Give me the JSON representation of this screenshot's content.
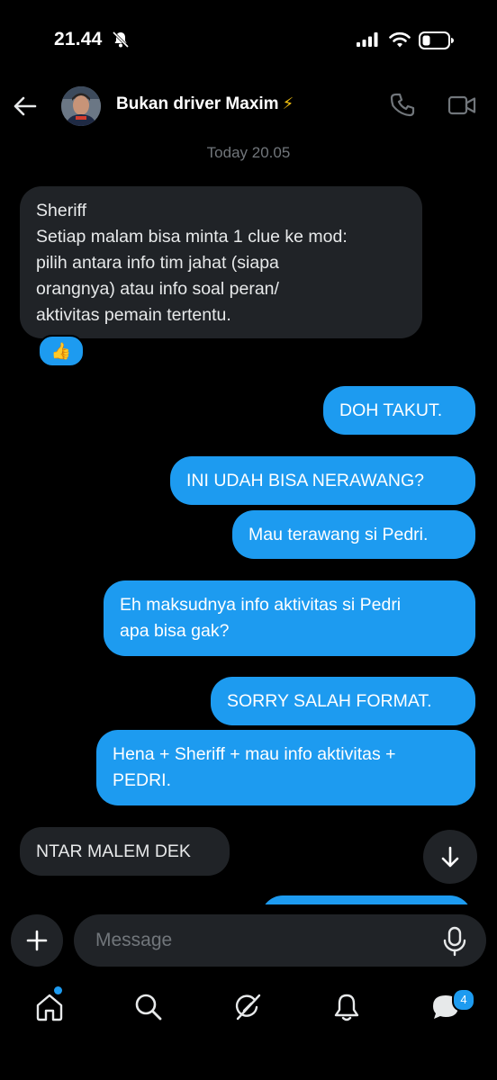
{
  "status_bar": {
    "time": "21.44"
  },
  "header": {
    "contact_name": "Bukan driver Maxim",
    "name_emoji": "⚡"
  },
  "conversation": {
    "date_separator": "Today 20.05",
    "messages": [
      {
        "direction": "incoming",
        "text": "Sheriff\nSetiap malam bisa minta 1 clue ke mod:\npilih antara info tim jahat (siapa\norangnya) atau info soal peran/\naktivitas pemain tertentu."
      },
      {
        "direction": "outgoing",
        "text": "DOH TAKUT."
      },
      {
        "direction": "outgoing",
        "text": "INI UDAH BISA NERAWANG?"
      },
      {
        "direction": "outgoing",
        "text": "Mau terawang si Pedri."
      },
      {
        "direction": "outgoing",
        "text": "Eh maksudnya info aktivitas si Pedri\napa bisa gak?"
      },
      {
        "direction": "outgoing",
        "text": "SORRY SALAH FORMAT."
      },
      {
        "direction": "outgoing",
        "text": "Hena + Sheriff + mau info aktivitas +\nPEDRI."
      },
      {
        "direction": "incoming",
        "text": "NTAR MALEM DEK"
      }
    ],
    "reaction": "👍"
  },
  "composer": {
    "placeholder": "Message"
  },
  "tabbar": {
    "messages_badge": "4"
  },
  "colors": {
    "accent": "#1d9bf0",
    "incoming_bubble": "#202327",
    "muted_text": "#71767b",
    "background": "#000000"
  }
}
